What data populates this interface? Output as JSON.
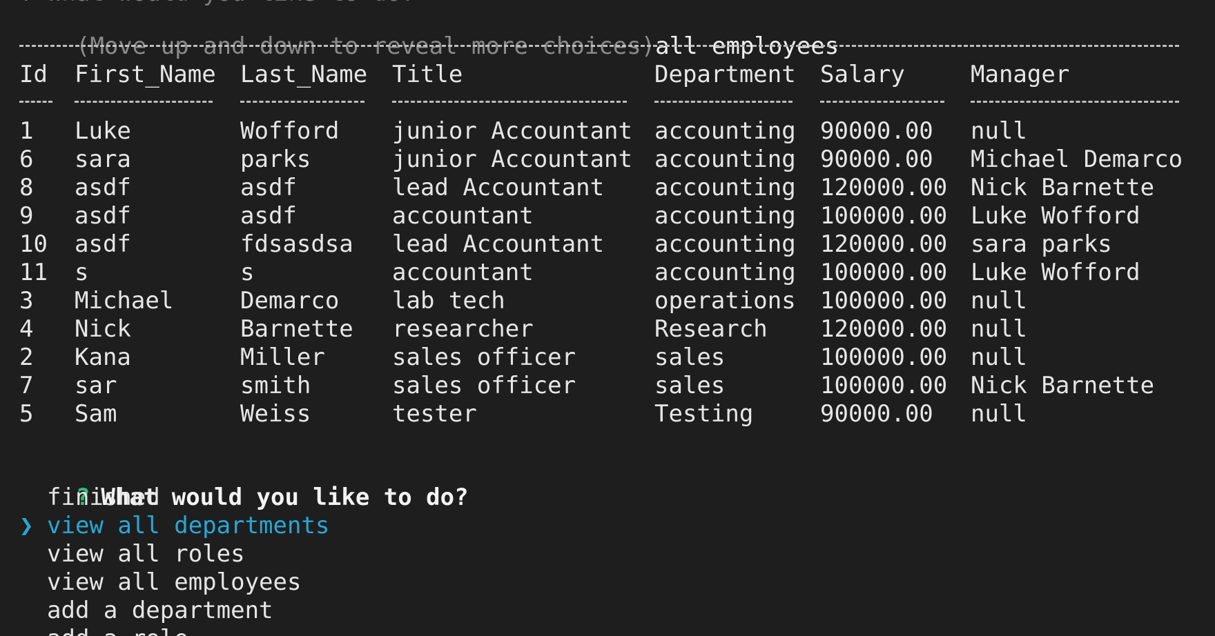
{
  "terminal": {
    "partial_top_line": "? What would you like to do?",
    "hint": "(Move up and down to reveal more choices)",
    "answer": "all employees",
    "table": {
      "columns": [
        "Id",
        "First_Name",
        "Last_Name",
        "Title",
        "Department",
        "Salary",
        "Manager"
      ],
      "rows": [
        [
          "1",
          "Luke",
          "Wofford",
          "junior Accountant",
          "accounting",
          "90000.00",
          "null"
        ],
        [
          "6",
          "sara",
          "parks",
          "junior Accountant",
          "accounting",
          "90000.00",
          "Michael Demarco"
        ],
        [
          "8",
          "asdf",
          "asdf",
          "lead Accountant",
          "accounting",
          "120000.00",
          "Nick Barnette"
        ],
        [
          "9",
          "asdf",
          "asdf",
          "accountant",
          "accounting",
          "100000.00",
          "Luke Wofford"
        ],
        [
          "10",
          "asdf",
          "fdsasdsa",
          "lead Accountant",
          "accounting",
          "120000.00",
          "sara parks"
        ],
        [
          "11",
          "s",
          "s",
          "accountant",
          "accounting",
          "100000.00",
          "Luke Wofford"
        ],
        [
          "3",
          "Michael",
          "Demarco",
          "lab tech",
          "operations",
          "100000.00",
          "null"
        ],
        [
          "4",
          "Nick",
          "Barnette",
          "researcher",
          "Research",
          "120000.00",
          "null"
        ],
        [
          "2",
          "Kana",
          "Miller",
          "sales officer",
          "sales",
          "100000.00",
          "null"
        ],
        [
          "7",
          "sar",
          "smith",
          "sales officer",
          "sales",
          "100000.00",
          "Nick Barnette"
        ],
        [
          "5",
          "Sam",
          "Weiss",
          "tester",
          "Testing",
          "90000.00",
          "null"
        ]
      ]
    },
    "question_mark": "?",
    "question": "What would you like to do?",
    "pointer": "❯",
    "menu": [
      {
        "label": "finished",
        "selected": false
      },
      {
        "label": "view all departments",
        "selected": true
      },
      {
        "label": "view all roles",
        "selected": false
      },
      {
        "label": "view all employees",
        "selected": false
      },
      {
        "label": "add a department",
        "selected": false
      },
      {
        "label": "add a role",
        "selected": false
      }
    ],
    "colors": {
      "background": "#1e1e1e",
      "text": "#e6e6e6",
      "muted": "#8a8a8a",
      "question_mark": "#2dbd7a",
      "selection": "#28a7d6"
    }
  }
}
